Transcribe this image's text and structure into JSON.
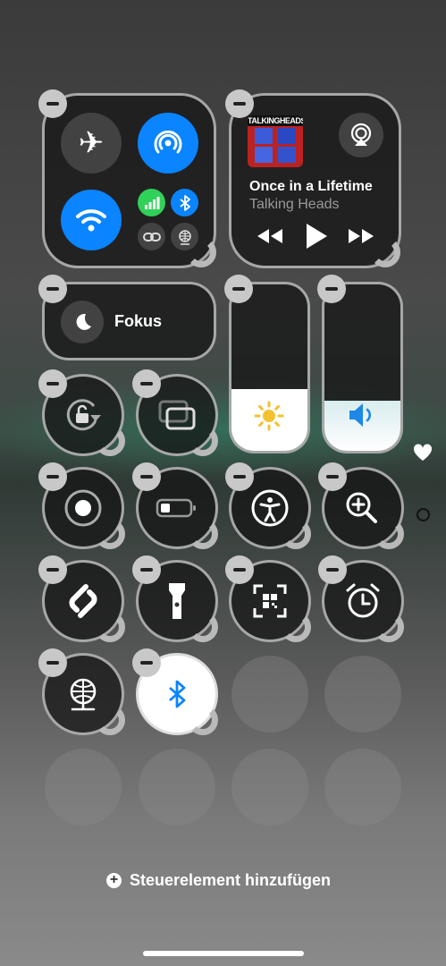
{
  "media": {
    "album_art_text": "TALKINGHEADS",
    "song_title": "Once in a Lifetime",
    "artist": "Talking Heads"
  },
  "focus": {
    "label": "Fokus"
  },
  "sliders": {
    "brightness_level": 0.37,
    "volume_level": 0.3
  },
  "add_control": {
    "label": "Steuerelement hinzufügen"
  },
  "colors": {
    "accent_blue": "#0a84ff",
    "cellular_green": "#30d158"
  },
  "icons": [
    "airplane-icon",
    "airdrop-icon",
    "wifi-icon",
    "cellular-icon",
    "bluetooth-icon",
    "link-icon",
    "globe-icon",
    "airplay-icon",
    "rewind-icon",
    "play-icon",
    "fast-forward-icon",
    "moon-icon",
    "sun-icon",
    "speaker-icon",
    "rotation-lock-icon",
    "screen-mirror-icon",
    "record-icon",
    "battery-icon",
    "accessibility-icon",
    "magnifier-icon",
    "shazam-icon",
    "flashlight-icon",
    "qr-code-icon",
    "alarm-icon",
    "heart-icon"
  ]
}
